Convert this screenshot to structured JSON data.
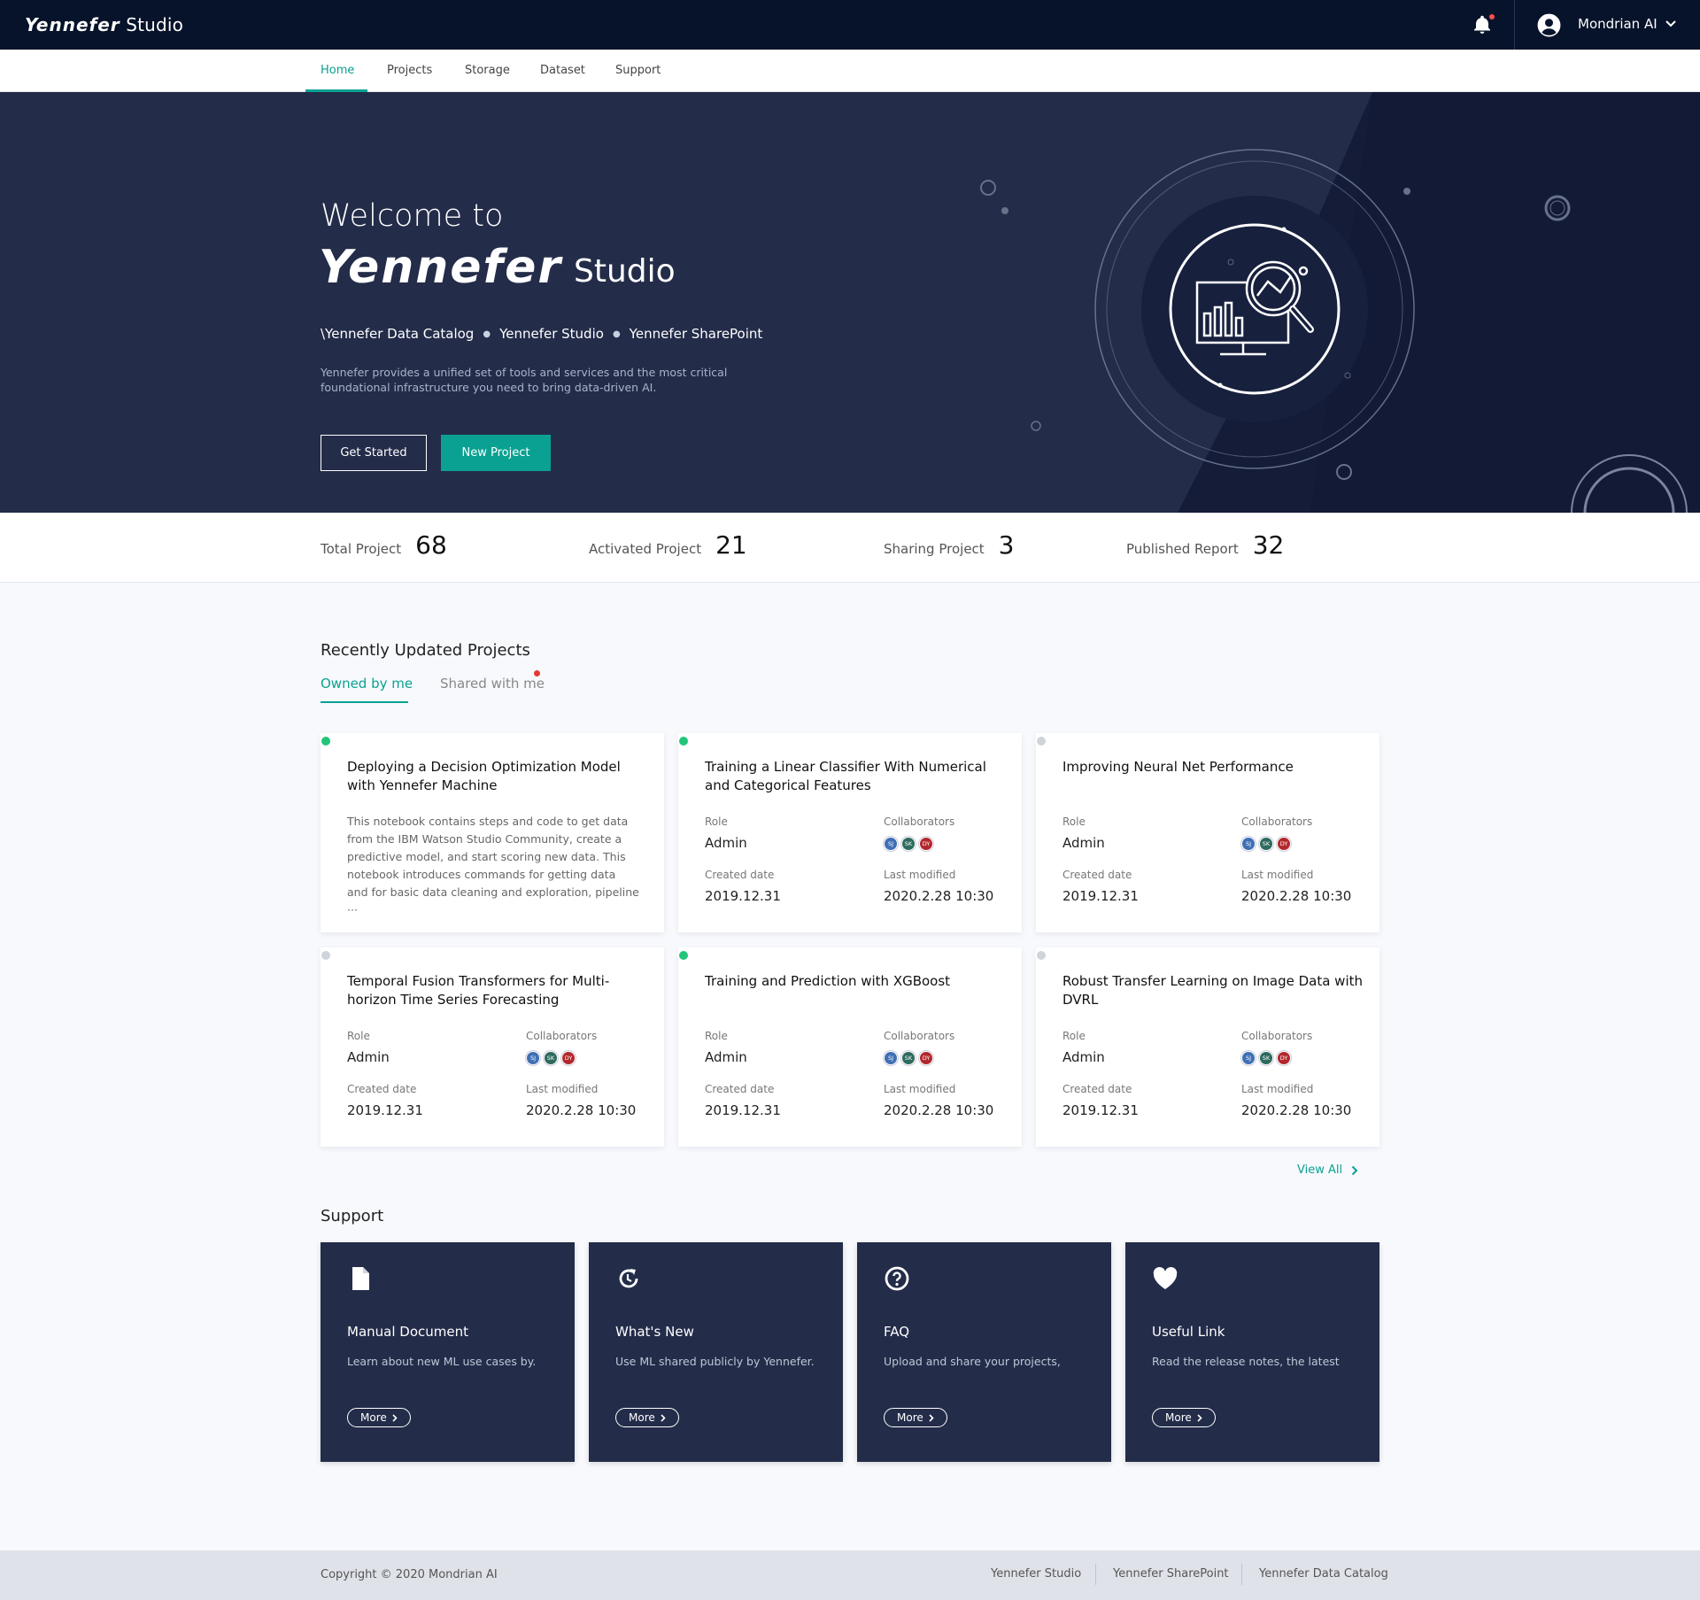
{
  "app": {
    "logo_brand": "Yennefer",
    "logo_sub": "Studio",
    "user_name": "Mondrian AI"
  },
  "nav": {
    "tabs": [
      {
        "label": "Home",
        "active": true
      },
      {
        "label": "Projects",
        "active": false
      },
      {
        "label": "Storage",
        "active": false
      },
      {
        "label": "Dataset",
        "active": false
      },
      {
        "label": "Support",
        "active": false
      }
    ]
  },
  "hero": {
    "welcome": "Welcome to",
    "brand": "Yennefer",
    "studio": "Studio",
    "links": [
      "\\Yennefer Data Catalog",
      "Yennefer Studio",
      "Yennefer SharePoint"
    ],
    "description": "Yennefer provides a unified set of tools and services and the most critical foundational infrastructure you need to bring data-driven AI.",
    "get_started": "Get Started",
    "new_project": "New Project"
  },
  "stats": [
    {
      "label": "Total Project",
      "value": "68"
    },
    {
      "label": "Activated Project",
      "value": "21"
    },
    {
      "label": "Sharing Project",
      "value": "3"
    },
    {
      "label": "Published Report",
      "value": "32"
    }
  ],
  "projects": {
    "title": "Recently Updated Projects",
    "tabs": [
      {
        "label": "Owned by me",
        "active": true
      },
      {
        "label": "Shared with me",
        "active": false
      }
    ],
    "role_label": "Role",
    "collab_label": "Collaborators",
    "created_label": "Created date",
    "modified_label": "Last modified",
    "cards": [
      {
        "title": "Deploying a Decision Optimization Model with Yennefer Machine",
        "active": true,
        "description": "This notebook contains steps and code to get data from the IBM Watson Studio Community, create a predictive model, and start scoring new data. This notebook introduces commands for getting data and for basic data cleaning and exploration, pipeline ···"
      },
      {
        "title": "Training a Linear Classifier With Numerical and Categorical Features",
        "active": true,
        "role": "Admin",
        "created": "2019.12.31",
        "modified": "2020.2.28 10:30"
      },
      {
        "title": "Improving Neural Net Performance",
        "active": false,
        "role": "Admin",
        "created": "2019.12.31",
        "modified": "2020.2.28 10:30"
      },
      {
        "title": "Temporal Fusion Transformers for Multi-horizon Time Series Forecasting",
        "active": false,
        "role": "Admin",
        "created": "2019.12.31",
        "modified": "2020.2.28 10:30"
      },
      {
        "title": "Training and Prediction with XGBoost",
        "active": true,
        "role": "Admin",
        "created": "2019.12.31",
        "modified": "2020.2.28 10:30"
      },
      {
        "title": "Robust Transfer Learning on Image Data with DVRL",
        "active": false,
        "role": "Admin",
        "created": "2019.12.31",
        "modified": "2020.2.28 10:30"
      }
    ],
    "collaborators": [
      {
        "initials": "SJ",
        "color": "#3f6fb5"
      },
      {
        "initials": "SK",
        "color": "#2e6b5e"
      },
      {
        "initials": "DY",
        "color": "#b3282d"
      }
    ],
    "view_all": "View All"
  },
  "support": {
    "title": "Support",
    "cards": [
      {
        "title": "Manual Document",
        "description": "Learn about new ML use cases by.",
        "more": "More",
        "icon": "document-icon"
      },
      {
        "title": "What's New",
        "description": "Use ML shared publicly by Yennefer.",
        "more": "More",
        "icon": "refresh-icon"
      },
      {
        "title": "FAQ",
        "description": "Upload and share your projects,",
        "more": "More",
        "icon": "question-icon"
      },
      {
        "title": "Useful Link",
        "description": "Read the release notes, the latest",
        "more": "More",
        "icon": "heart-icon"
      }
    ]
  },
  "footer": {
    "copyright": "Copyright © 2020 Mondrian AI",
    "links": [
      "Yennefer Studio",
      "Yennefer SharePoint",
      "Yennefer Data Catalog"
    ]
  },
  "colors": {
    "accent": "#0aa192",
    "topbar": "#07132a",
    "hero": "#232c49",
    "active_dot": "#22c57a",
    "inactive_dot": "#cfd3da",
    "alert": "#e53935"
  }
}
